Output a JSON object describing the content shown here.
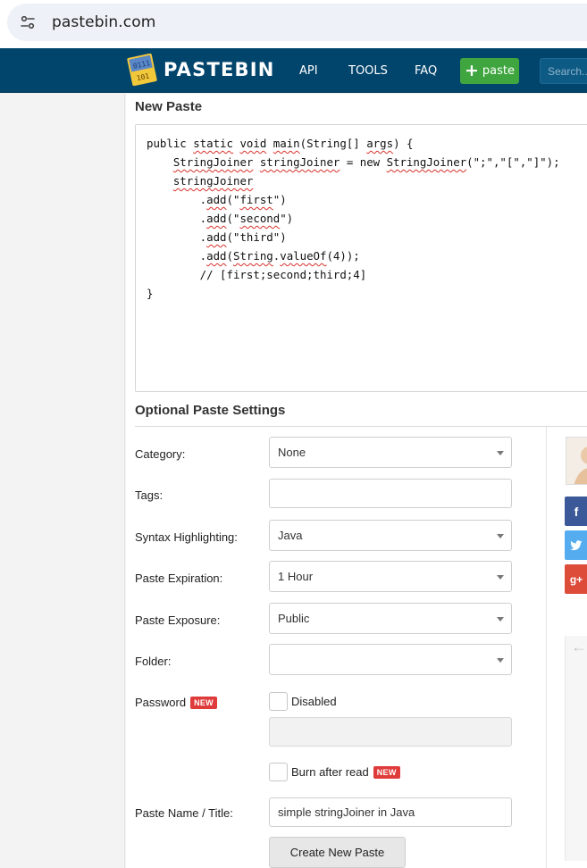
{
  "browser": {
    "url": "pastebin.com",
    "site_info_icon": "site-settings-icon"
  },
  "header": {
    "logo_text": "PASTEBIN",
    "nav": [
      "API",
      "TOOLS",
      "FAQ"
    ],
    "paste_button": "paste",
    "search_placeholder": "Search...",
    "colors": {
      "bar": "#02456c",
      "paste_button": "#3fa63f"
    }
  },
  "editor": {
    "title": "New Paste",
    "lines": [
      "public static void main(String[] args) {",
      "    StringJoiner stringJoiner = new StringJoiner(\";\",\"[\",\"]\");",
      "    stringJoiner",
      "        .add(\"first\")",
      "        .add(\"second\")",
      "        .add(\"third\")",
      "        .add(String.valueOf(4));",
      "        // [first;second;third;4]",
      "}"
    ]
  },
  "settings": {
    "title": "Optional Paste Settings",
    "category": {
      "label": "Category:",
      "value": "None"
    },
    "tags": {
      "label": "Tags:",
      "value": ""
    },
    "syntax": {
      "label": "Syntax Highlighting:",
      "value": "Java"
    },
    "expiration": {
      "label": "Paste Expiration:",
      "value": "1 Hour"
    },
    "exposure": {
      "label": "Paste Exposure:",
      "value": "Public"
    },
    "folder": {
      "label": "Folder:",
      "value": ""
    },
    "password": {
      "label": "Password",
      "badge": "NEW",
      "checkbox_label": "Disabled",
      "value": ""
    },
    "burn": {
      "label": "Burn after read",
      "badge": "NEW"
    },
    "name": {
      "label": "Paste Name / Title:",
      "value": "simple stringJoiner in Java"
    },
    "submit": "Create New Paste"
  },
  "sidebar": {
    "social": [
      {
        "icon": "facebook-icon",
        "glyph": "f",
        "color": "#3b5998"
      },
      {
        "icon": "twitter-icon",
        "glyph": "🐦",
        "color": "#55acee"
      },
      {
        "icon": "google-plus-icon",
        "glyph": "g+",
        "color": "#dd4b39"
      }
    ]
  }
}
